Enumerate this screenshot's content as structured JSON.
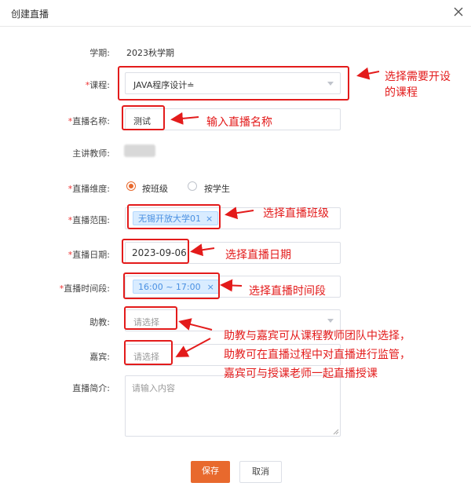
{
  "dialog": {
    "title": "创建直播"
  },
  "form": {
    "term_label": "学期:",
    "term_value": "2023秋学期",
    "course_label": "课程:",
    "course_value": "JAVA程序设计≐",
    "name_label": "直播名称:",
    "name_value": "测试",
    "teacher_label": "主讲教师:",
    "dimension_label": "直播维度:",
    "dimension_opt1": "按班级",
    "dimension_opt2": "按学生",
    "range_label": "直播范围:",
    "range_tag": "无锡开放大学01",
    "date_label": "直播日期:",
    "date_value": "2023-09-06",
    "time_label": "直播时间段:",
    "time_tag": "16:00 ~ 17:00",
    "assistant_label": "助教:",
    "assistant_placeholder": "请选择",
    "guest_label": "嘉宾:",
    "guest_placeholder": "请选择",
    "intro_label": "直播简介:",
    "intro_placeholder": "请输入内容"
  },
  "buttons": {
    "save": "保存",
    "cancel": "取消"
  },
  "annotations": {
    "course_note_1": "选择需要开设",
    "course_note_2": "的课程",
    "name_note": "输入直播名称",
    "range_note": "选择直播班级",
    "date_note": "选择直播日期",
    "time_note": "选择直播时间段",
    "staff_note_1": "助教与嘉宾可从课程教师团队中选择，",
    "staff_note_2": "助教可在直播过程中对直播进行监管，",
    "staff_note_3": "嘉宾可与授课老师一起直播授课"
  },
  "colors": {
    "accent": "#e8692d",
    "annotation": "#e31b1b",
    "tag_bg": "#d9ecff"
  }
}
